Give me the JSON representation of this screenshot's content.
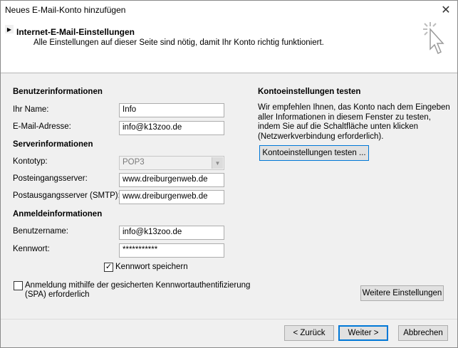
{
  "window": {
    "title": "Neues E-Mail-Konto hinzufügen",
    "close_glyph": "✕"
  },
  "header": {
    "title": "Internet-E-Mail-Einstellungen",
    "subtitle": "Alle Einstellungen auf dieser Seite sind nötig, damit Ihr Konto richtig funktioniert."
  },
  "user_info": {
    "section": "Benutzerinformationen",
    "name_label": "Ihr Name:",
    "name_value": "Info",
    "email_label": "E-Mail-Adresse:",
    "email_value": "info@k13zoo.de"
  },
  "server_info": {
    "section": "Serverinformationen",
    "account_type_label": "Kontotyp:",
    "account_type_value": "POP3",
    "incoming_label": "Posteingangsserver:",
    "incoming_value": "www.dreiburgenweb.de",
    "outgoing_label": "Postausgangsserver (SMTP):",
    "outgoing_value": "www.dreiburgenweb.de"
  },
  "login_info": {
    "section": "Anmeldeinformationen",
    "username_label": "Benutzername:",
    "username_value": "info@k13zoo.de",
    "password_label": "Kennwort:",
    "password_value": "***********",
    "save_password_label": "Kennwort speichern",
    "save_password_checked": true,
    "spa_label_line1": "Anmeldung mithilfe der gesicherten Kennwortauthentifizierung",
    "spa_label_line2": "(SPA) erforderlich",
    "spa_checked": false
  },
  "test": {
    "section": "Kontoeinstellungen testen",
    "description": "Wir empfehlen Ihnen, das Konto nach dem Eingeben aller Informationen in diesem Fenster zu testen, indem Sie auf die Schaltfläche unten klicken (Netzwerkverbindung erforderlich).",
    "test_button": "Kontoeinstellungen testen ..."
  },
  "more_settings_button": "Weitere Einstellungen",
  "footer": {
    "back": "< Zurück",
    "next": "Weiter >",
    "cancel": "Abbrechen"
  },
  "check_glyph": "✓"
}
